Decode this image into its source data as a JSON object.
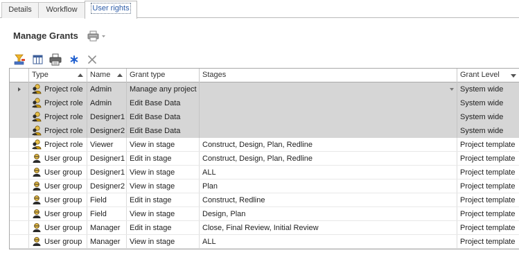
{
  "tabs": [
    {
      "label": "Details"
    },
    {
      "label": "Workflow"
    },
    {
      "label": "User rights"
    }
  ],
  "page_title": "Manage Grants",
  "toolbar": {
    "buttons": [
      {
        "icon": "filter-icon"
      },
      {
        "icon": "column-chooser-icon"
      },
      {
        "icon": "print-icon"
      },
      {
        "icon": "add-icon"
      },
      {
        "icon": "delete-icon"
      }
    ]
  },
  "grid": {
    "columns": [
      {
        "label": "Type"
      },
      {
        "label": "Name"
      },
      {
        "label": "Grant type"
      },
      {
        "label": "Stages"
      },
      {
        "label": "Grant Level"
      }
    ],
    "rows": [
      {
        "type": "Project role",
        "name": "Admin",
        "grant_type": "Manage any project",
        "stages": "",
        "level": "System wide"
      },
      {
        "type": "Project role",
        "name": "Admin",
        "grant_type": "Edit Base Data",
        "stages": "",
        "level": "System wide"
      },
      {
        "type": "Project role",
        "name": "Designer1",
        "grant_type": "Edit Base Data",
        "stages": "",
        "level": "System wide"
      },
      {
        "type": "Project role",
        "name": "Designer2",
        "grant_type": "Edit Base Data",
        "stages": "",
        "level": "System wide"
      },
      {
        "type": "Project role",
        "name": "Viewer",
        "grant_type": "View in stage",
        "stages": "Construct, Design, Plan, Redline",
        "level": "Project template"
      },
      {
        "type": "User group",
        "name": "Designer1",
        "grant_type": "Edit in stage",
        "stages": "Construct, Design, Plan, Redline",
        "level": "Project template"
      },
      {
        "type": "User group",
        "name": "Designer1",
        "grant_type": "View in stage",
        "stages": "ALL",
        "level": "Project template"
      },
      {
        "type": "User group",
        "name": "Designer2",
        "grant_type": "View in stage",
        "stages": "Plan",
        "level": "Project template"
      },
      {
        "type": "User group",
        "name": "Field",
        "grant_type": "Edit in stage",
        "stages": "Construct, Redline",
        "level": "Project template"
      },
      {
        "type": "User group",
        "name": "Field",
        "grant_type": "View in stage",
        "stages": "Design, Plan",
        "level": "Project template"
      },
      {
        "type": "User group",
        "name": "Manager",
        "grant_type": "Edit in stage",
        "stages": "Close, Final Review, Initial Review",
        "level": "Project template"
      },
      {
        "type": "User group",
        "name": "Manager",
        "grant_type": "View in stage",
        "stages": "ALL",
        "level": "Project template"
      }
    ]
  },
  "colors": {
    "selected_row": "#d6d6d6",
    "active_tab_text": "#2a5aa7",
    "icon_gold": "#c89a12"
  }
}
